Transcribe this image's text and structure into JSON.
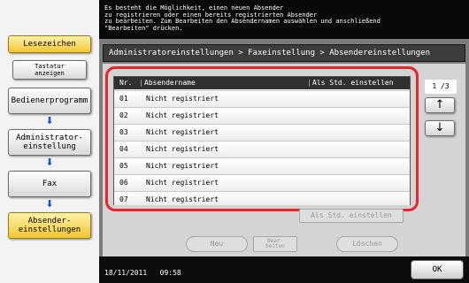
{
  "left_panel": {
    "bookmark": "Lesezeichen",
    "keyboard": "Tastatur\nanzeigen",
    "items": [
      {
        "label": "Bedienerprogramm"
      },
      {
        "label": "Administrator-\neinstellung"
      },
      {
        "label": "Fax"
      },
      {
        "label": "Absender-\neinstellungen"
      }
    ],
    "arrow_glyph": "⬇",
    "colors": {
      "active_yellow": "#f2c630",
      "arrow_blue": "#1856c4"
    }
  },
  "message": "Es besteht die Möglichkeit, einen neuen Absender\nzu registrieren oder einen bereits registrierten Absender\nzu bearbeiten. Zum Bearbeiten den Absendernamen auswählen und anschließend\n\"Bearbeiten\" drücken.",
  "breadcrumb": "Administratoreinstellungen > Faxeinstellung > Absendereinstellungen",
  "list": {
    "headers": {
      "nr": "Nr.",
      "name": "Absendername",
      "default": "Als Std. einstellen"
    },
    "rows": [
      {
        "nr": "01",
        "name": "Nicht registriert"
      },
      {
        "nr": "02",
        "name": "Nicht registriert"
      },
      {
        "nr": "03",
        "name": "Nicht registriert"
      },
      {
        "nr": "04",
        "name": "Nicht registriert"
      },
      {
        "nr": "05",
        "name": "Nicht registriert"
      },
      {
        "nr": "06",
        "name": "Nicht registriert"
      },
      {
        "nr": "07",
        "name": "Nicht registriert"
      }
    ],
    "highlight_color": "#e8232a"
  },
  "scroll": {
    "page": "1 /3",
    "up_icon": "arrow-up-icon",
    "down_icon": "arrow-down-icon",
    "up_glyph": "↑",
    "down_glyph": "↓"
  },
  "buttons": {
    "set_default": "Als Std. einstellen",
    "new": "Neu",
    "edit": "Bear-\nbeiten",
    "delete": "Löschen",
    "ok": "OK"
  },
  "status": {
    "date": "18/11/2011",
    "time": "09:58"
  }
}
